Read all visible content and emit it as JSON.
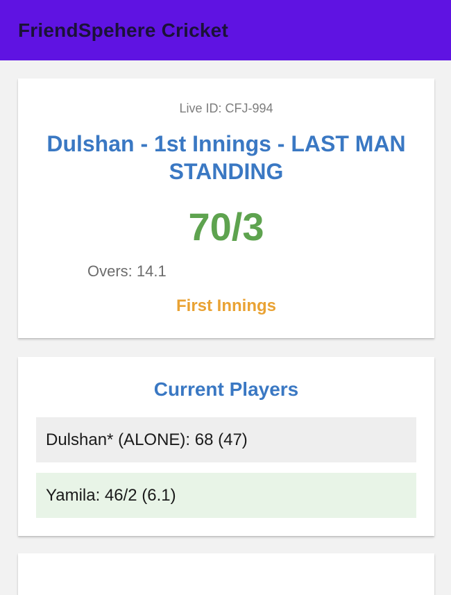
{
  "app": {
    "title": "FriendSpehere Cricket"
  },
  "score_card": {
    "live_id": "Live ID: CFJ-994",
    "innings_title": "Dulshan - 1st Innings - LAST MAN STANDING",
    "score": "70/3",
    "overs": "Overs: 14.1",
    "innings_status": "First Innings",
    "colors": {
      "title": "#3a78c3",
      "score": "#5ea34f",
      "status": "#e9a233"
    }
  },
  "current_players": {
    "title": "Current Players",
    "rows": [
      {
        "text": "Dulshan* (ALONE): 68 (47)",
        "background": "#eeeeee"
      },
      {
        "text": "Yamila: 46/2 (6.1)",
        "background": "#e8f4e7"
      }
    ]
  },
  "theme": {
    "app_bar": "#5f13e2",
    "page_background": "#f2f2f2"
  }
}
